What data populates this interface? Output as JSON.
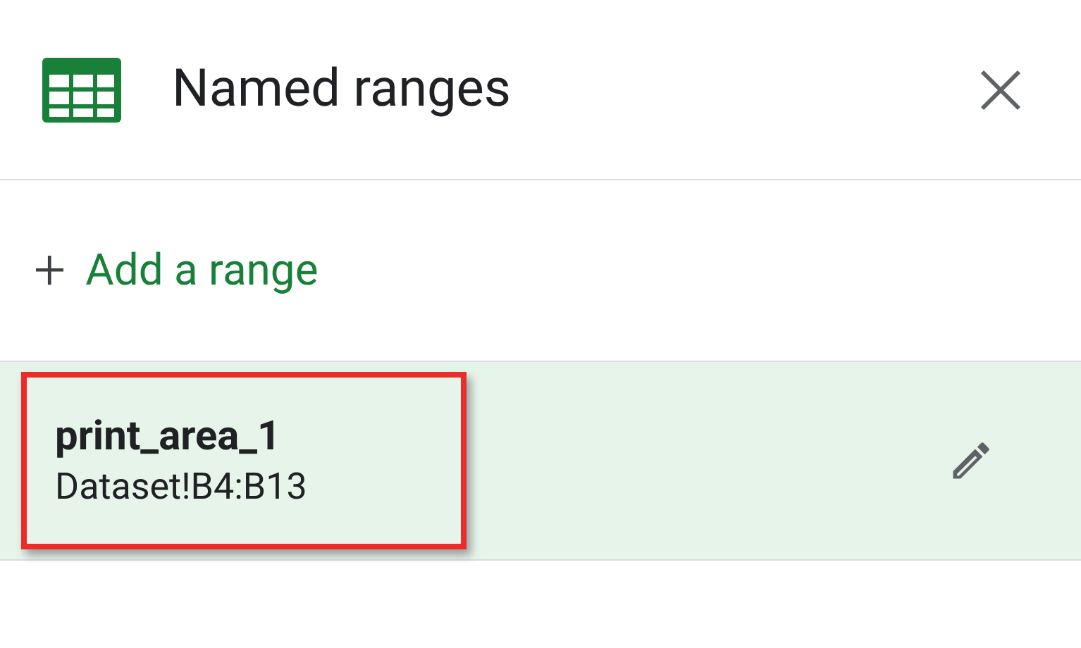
{
  "panel": {
    "title": "Named ranges"
  },
  "add_link": {
    "icon": "+",
    "label": "Add a range"
  },
  "ranges": [
    {
      "name": "print_area_1",
      "reference": "Dataset!B4:B13",
      "selected": true,
      "highlighted": true
    }
  ]
}
